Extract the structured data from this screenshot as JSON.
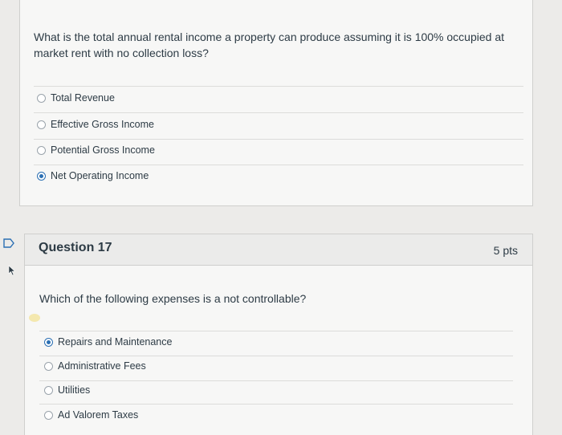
{
  "question16": {
    "text": "What is the total annual rental income a property can produce assuming it is 100% occupied at market rent with no collection loss?",
    "answers": [
      {
        "label": "Total Revenue",
        "selected": false
      },
      {
        "label": "Effective Gross Income",
        "selected": false
      },
      {
        "label": "Potential Gross Income",
        "selected": false
      },
      {
        "label": "Net Operating Income",
        "selected": true
      }
    ]
  },
  "question17": {
    "title": "Question 17",
    "points": "5 pts",
    "text": "Which of the following expenses is a not controllable?",
    "answers": [
      {
        "label": "Repairs and Maintenance",
        "selected": true
      },
      {
        "label": "Administrative Fees",
        "selected": false
      },
      {
        "label": "Utilities",
        "selected": false
      },
      {
        "label": "Ad Valorem Taxes",
        "selected": false
      }
    ]
  },
  "colors": {
    "accent": "#2b6fb3",
    "background": "#ecebe9",
    "card": "#f7f7f6"
  }
}
